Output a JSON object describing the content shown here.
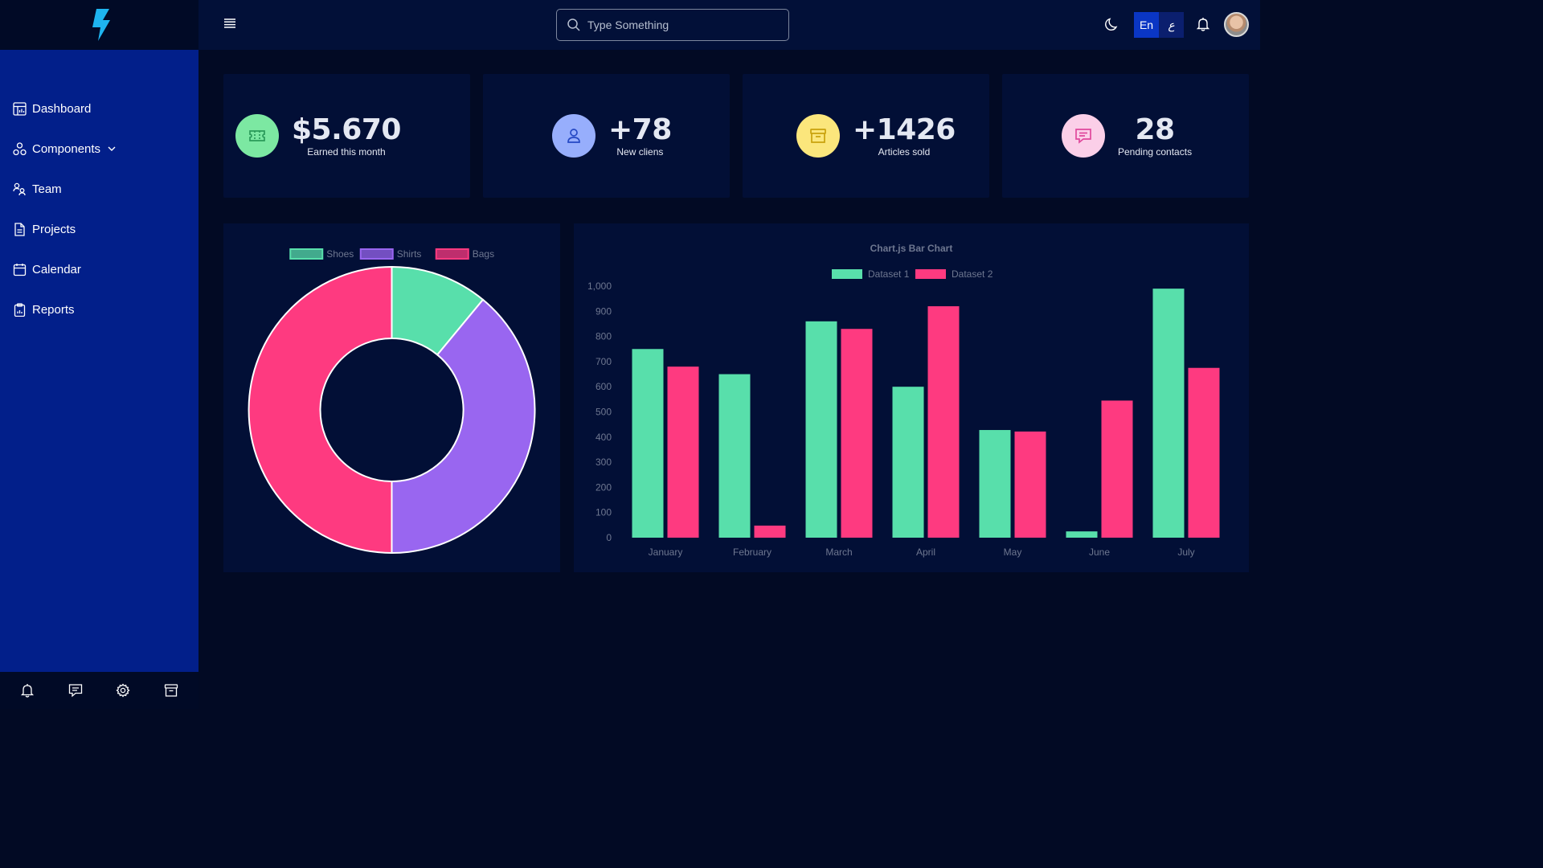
{
  "app": {
    "logo_icon": "lightning-bolt-icon",
    "accent": "#1eb4f0"
  },
  "sidebar": {
    "items": [
      {
        "label": "Dashboard",
        "icon": "dashboard-icon"
      },
      {
        "label": "Components",
        "icon": "components-icon",
        "has_submenu": true
      },
      {
        "label": "Team",
        "icon": "team-icon"
      },
      {
        "label": "Projects",
        "icon": "document-icon"
      },
      {
        "label": "Calendar",
        "icon": "calendar-icon"
      },
      {
        "label": "Reports",
        "icon": "clipboard-icon"
      }
    ],
    "footer_icons": [
      "bell-icon",
      "chat-icon",
      "gear-icon",
      "archive-icon"
    ]
  },
  "header": {
    "menu_icon": "hamburger-icon",
    "search": {
      "placeholder": "Type Something"
    },
    "theme_icon": "moon-icon",
    "languages": [
      {
        "label": "En",
        "active": true
      },
      {
        "label": "ع",
        "active": false
      }
    ],
    "notification_icon": "bell-icon"
  },
  "stats": [
    {
      "value": "$5.670",
      "label": "Earned this month",
      "icon": "ticket-icon",
      "bg": "#7ce8a2",
      "fg": "#2a9a5a"
    },
    {
      "value": "+78",
      "label": "New cliens",
      "icon": "user-icon",
      "bg": "#97aefc",
      "fg": "#2548c4"
    },
    {
      "value": "+1426",
      "label": "Articles sold",
      "icon": "archive-icon",
      "bg": "#fbe67c",
      "fg": "#c9a10c"
    },
    {
      "value": "28",
      "label": "Pending contacts",
      "icon": "chat-icon",
      "bg": "#fbcfe8",
      "fg": "#e0489c"
    }
  ],
  "chart_data": [
    {
      "type": "pie",
      "variant": "doughnut",
      "categories": [
        "Shoes",
        "Shirts",
        "Bags"
      ],
      "values": [
        11,
        39,
        50
      ],
      "colors": [
        "#58dfab",
        "#9966f0",
        "#fe3a80"
      ],
      "legend": "top"
    },
    {
      "type": "bar",
      "title": "Chart.js Bar Chart",
      "categories": [
        "January",
        "February",
        "March",
        "April",
        "May",
        "June",
        "July"
      ],
      "series": [
        {
          "name": "Dataset 1",
          "values": [
            750,
            650,
            860,
            600,
            428,
            25,
            990
          ],
          "color": "#58dfab"
        },
        {
          "name": "Dataset 2",
          "values": [
            680,
            48,
            830,
            920,
            422,
            545,
            675
          ],
          "color": "#fe3a80"
        }
      ],
      "ylim": [
        0,
        1000
      ],
      "yticks": [
        "0",
        "100",
        "200",
        "300",
        "400",
        "500",
        "600",
        "700",
        "800",
        "900",
        "1,000"
      ],
      "legend": "top",
      "grid": false
    }
  ]
}
